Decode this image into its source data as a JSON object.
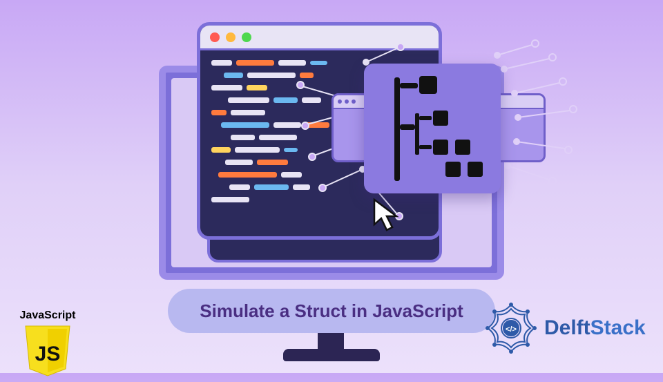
{
  "title": "Simulate a Struct in JavaScript",
  "js_badge": {
    "label": "JavaScript",
    "shield_text": "JS"
  },
  "delftstack": {
    "brand": "DelftStack",
    "code_glyph": "</>"
  },
  "colors": {
    "bg_top": "#c8a8f5",
    "bg_bottom": "#ece1fb",
    "monitor_border": "#9b8be8",
    "monitor_fill": "#7c6fd9",
    "code_bg": "#2c2a5c",
    "pill_bg": "#b8b8f0",
    "title_color": "#4a2e82",
    "overlay": "#8b7ae0",
    "brand_blue": "#2e5aa8",
    "js_yellow": "#f7df1e"
  }
}
